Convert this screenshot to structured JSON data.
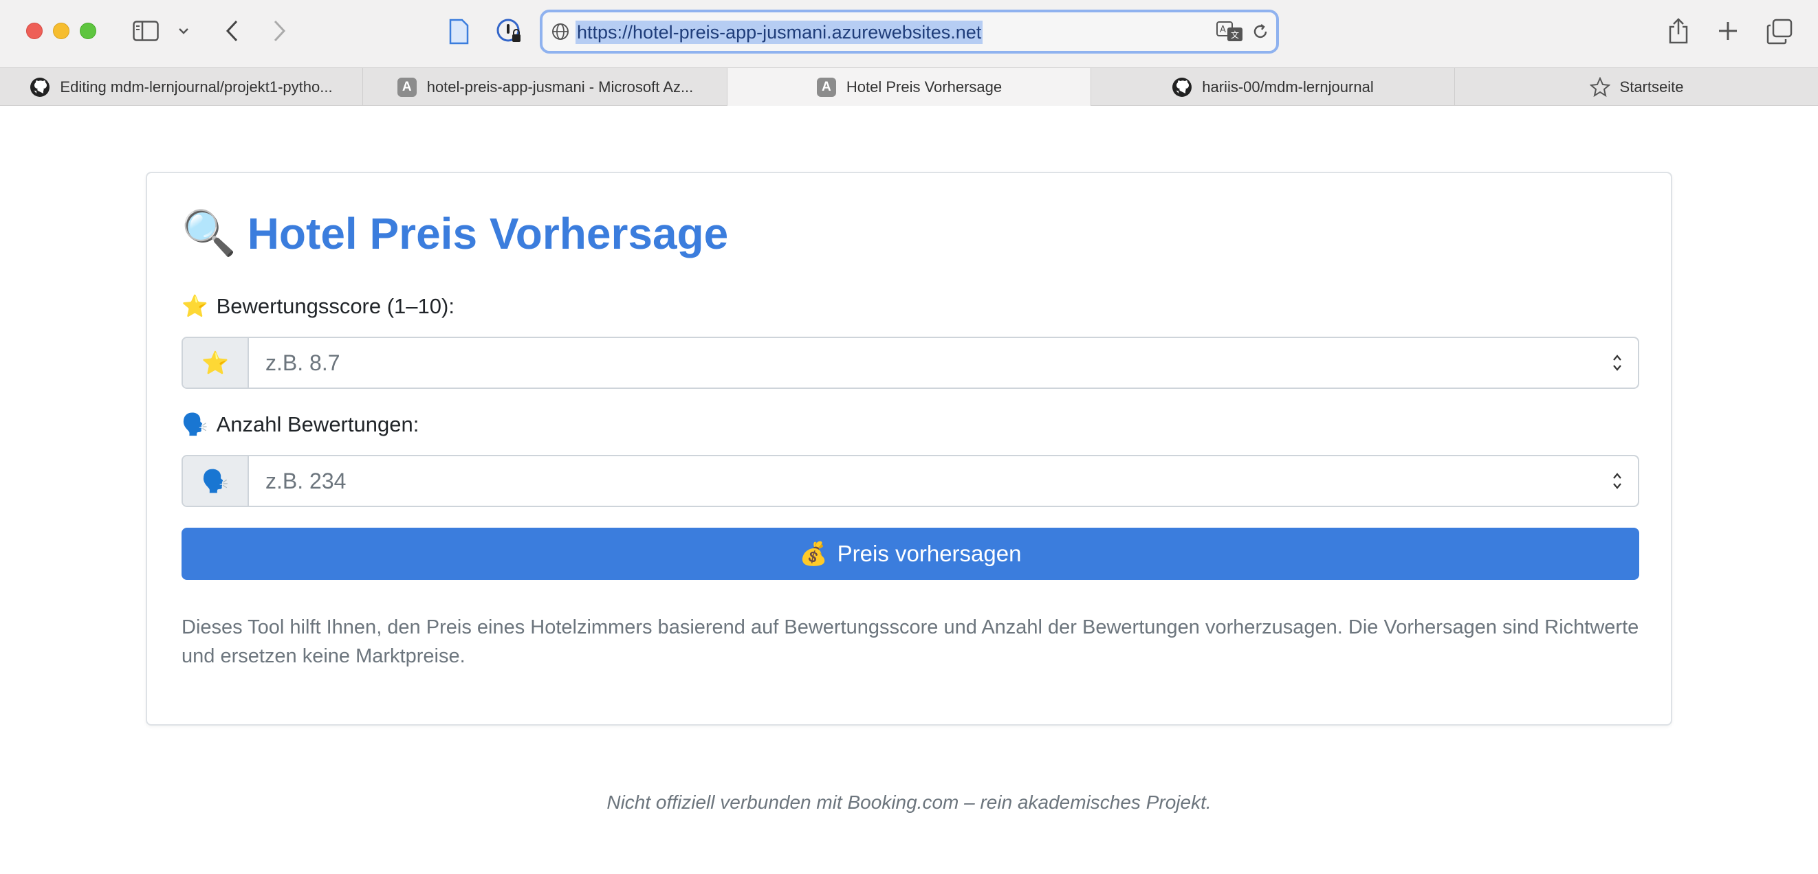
{
  "browser": {
    "url": "https://hotel-preis-app-jusmani.azurewebsites.net",
    "tabs": [
      {
        "label": "Editing mdm-lernjournal/projekt1-pytho...",
        "icon": "github-icon",
        "active": false
      },
      {
        "label": "hotel-preis-app-jusmani - Microsoft Az...",
        "icon": "azure-app-icon",
        "active": false
      },
      {
        "label": "Hotel Preis Vorhersage",
        "icon": "azure-app-icon",
        "active": true
      },
      {
        "label": "hariis-00/mdm-lernjournal",
        "icon": "github-icon",
        "active": false
      },
      {
        "label": "Startseite",
        "icon": "star-outline-icon",
        "active": false
      }
    ]
  },
  "page": {
    "title_emoji": "🔍",
    "title": "Hotel Preis Vorhersage",
    "score": {
      "label_emoji": "⭐",
      "label": "Bewertungsscore (1–10):",
      "addon": "⭐",
      "placeholder": "z.B. 8.7",
      "value": ""
    },
    "reviews": {
      "label_emoji": "🗣️",
      "label": "Anzahl Bewertungen:",
      "addon": "🗣️",
      "placeholder": "z.B. 234",
      "value": ""
    },
    "button": {
      "emoji": "💰",
      "label": "Preis vorhersagen"
    },
    "info": "Dieses Tool hilft Ihnen, den Preis eines Hotelzimmers basierend auf Bewertungsscore und Anzahl der Bewertungen vorherzusagen. Die Vorhersagen sind Richtwerte und ersetzen keine Marktpreise.",
    "footer": "Nicht offiziell verbunden mit Booking.com – rein akademisches Projekt."
  },
  "colors": {
    "accent": "#3b7ddd",
    "muted_text": "#6c757d",
    "border": "#dee2e6"
  }
}
